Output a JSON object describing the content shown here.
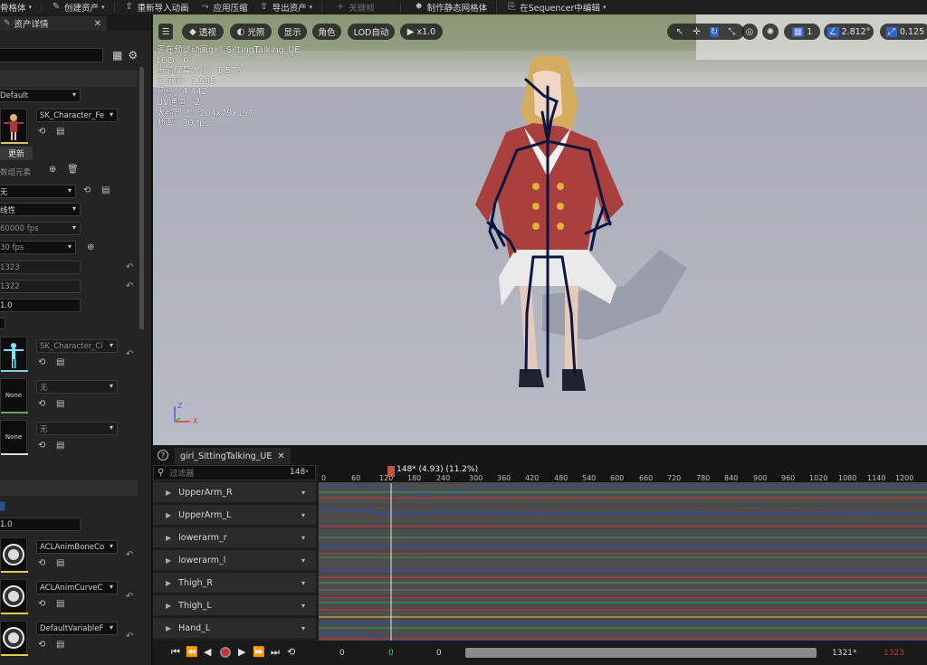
{
  "toolbar": {
    "items": [
      {
        "label": "骨格体",
        "icon": "mesh-icon"
      },
      {
        "label": "创建资产",
        "icon": "create-asset-icon"
      },
      {
        "label": "重新导入动画",
        "icon": "reimport-icon"
      },
      {
        "label": "应用压缩",
        "icon": "compress-icon"
      },
      {
        "label": "导出资产",
        "icon": "export-icon"
      },
      {
        "label": "关键帧",
        "icon": "keyframe-icon"
      },
      {
        "label": "制作静态网格体",
        "icon": "static-mesh-icon"
      },
      {
        "label": "在Sequencer中编辑",
        "icon": "sequencer-icon"
      }
    ]
  },
  "details": {
    "tab_label": "资产详情",
    "preview_mesh_combo": "Default",
    "skeleton_asset": "SK_Character_Fe",
    "update_button": "更新",
    "array_elements": "数组元素",
    "none_combo": "无",
    "interpolation": "线性",
    "sample_rate": "60000 fps",
    "frame_rate": "30 fps",
    "num_frames": "1323",
    "num_keys": "1322",
    "rate_scale": "1.0",
    "skeleton_asset2": "SK_Character_Ci",
    "thumb_none_1": "None",
    "thumb_none_2": "None",
    "none_combo_2": "无",
    "none_combo_3": "无",
    "value_10": "1.0",
    "bone_codec": "ACLAnimBoneCo",
    "curve_codec": "ACLAnimCurveC",
    "variable_codec": "DefaultVariableF"
  },
  "viewport": {
    "buttons": [
      {
        "label": "透视",
        "icon": "perspective-icon"
      },
      {
        "label": "光照",
        "icon": "lighting-icon"
      },
      {
        "label": "显示",
        "icon": ""
      },
      {
        "label": "角色",
        "icon": ""
      },
      {
        "label": "LOD自动",
        "icon": ""
      },
      {
        "label": "x1.0",
        "icon": "play-icon"
      }
    ],
    "grid_value": "1",
    "angle_value": "2.812°",
    "scale_value": "0.125",
    "stats": [
      "正在预览动画girl_SittingTalking_UE",
      "LOD：0",
      "当前屏幕大小：1.573",
      "三角形：1,995",
      "顶点：4,442",
      "UV通道：2",
      "大约尺寸：204x79x197",
      "帧率：30 fps"
    ],
    "axis_z": "Z",
    "axis_x": "X"
  },
  "anim": {
    "tab_label": "girl_SittingTalking_UE",
    "search_placeholder": "过滤器",
    "frame_count": "148",
    "playhead_label": "148* (4.93) (11.2%)",
    "ticks": [
      "0",
      "60",
      "120",
      "180",
      "240",
      "300",
      "360",
      "420",
      "480",
      "540",
      "600",
      "660",
      "720",
      "780",
      "840",
      "900",
      "960",
      "1020",
      "1080",
      "1140",
      "1200"
    ],
    "tracks": [
      "UpperArm_R",
      "UpperArm_L",
      "lowerarm_r",
      "lowerarm_l",
      "Thigh_R",
      "Thigh_L",
      "Hand_L"
    ],
    "range_start": "0",
    "range_cur": "0",
    "range_mid": "0",
    "range_end": "1321*",
    "range_end2": "1323"
  },
  "colors": {
    "accent_blue": "#2f63c7",
    "record_red": "#d12c2c",
    "curve_red": "#c8343b",
    "curve_green": "#2fa84a",
    "curve_blue": "#2645c9"
  }
}
